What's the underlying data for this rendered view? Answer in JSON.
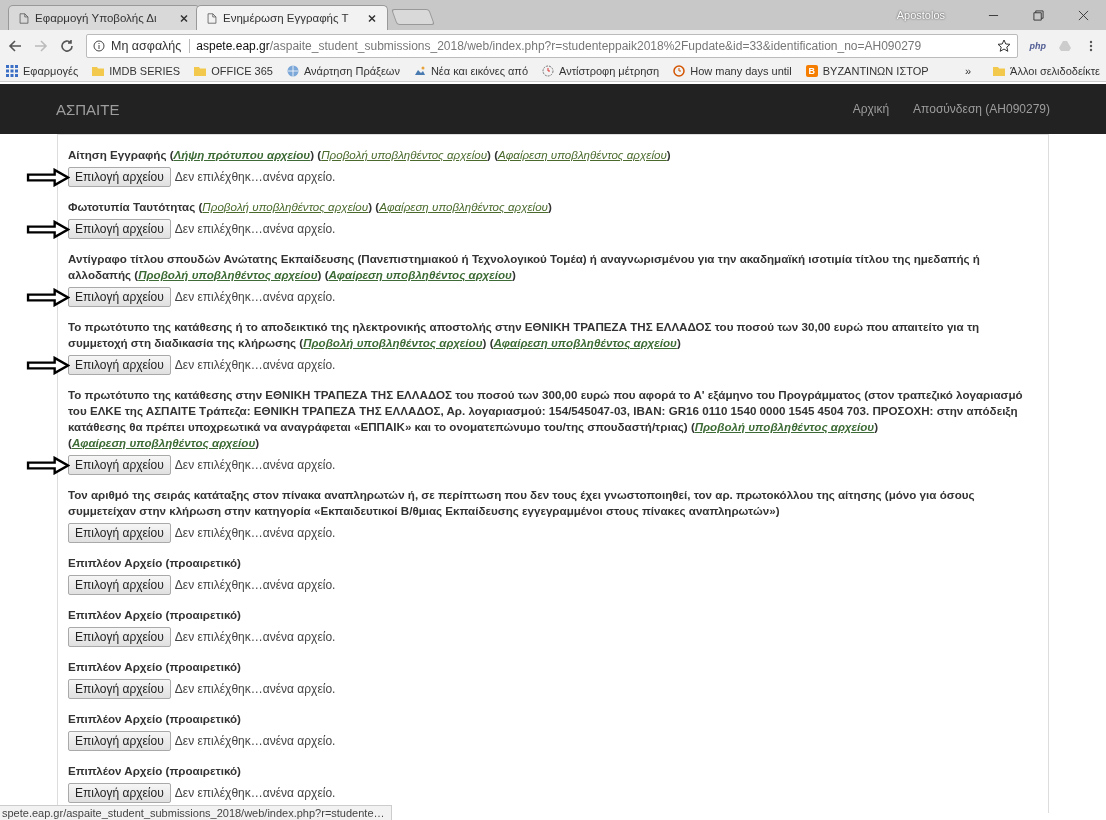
{
  "browser": {
    "tabs": [
      {
        "title": "Εφαρμογή Υποβολής Δι",
        "selected": false
      },
      {
        "title": "Ενημέρωση Εγγραφής Τ",
        "selected": true
      }
    ],
    "profile": "Apostolos",
    "address": {
      "security": "Μη ασφαλής",
      "host": "aspete.eap.gr",
      "path": "/aspaite_student_submissions_2018/web/index.php?r=studenteppaik2018%2Fupdate&id=33&identification_no=AH090279"
    },
    "extension_label": "php",
    "bookmarks": [
      {
        "kind": "apps",
        "label": "Εφαρμογές"
      },
      {
        "kind": "folder",
        "label": "IMDB SERIES"
      },
      {
        "kind": "folder",
        "label": "OFFICE 365"
      },
      {
        "kind": "globe",
        "label": "Ανάρτηση Πράξεων"
      },
      {
        "kind": "picture",
        "label": "Νέα και εικόνες από"
      },
      {
        "kind": "timer",
        "label": "Αντίστροφη μέτρηση"
      },
      {
        "kind": "clock",
        "label": "How many days until"
      },
      {
        "kind": "letter",
        "badge": "B",
        "label": "ΒΥΖΑΝΤΙΝΩΝ ΙΣΤΟΡ"
      }
    ],
    "more_bookmarks": "»",
    "other_bookmarks": "Άλλοι σελιδοδείκτε",
    "status_url": "spete.eap.gr/aspaite_student_submissions_2018/web/index.php?r=studente…"
  },
  "navbar": {
    "brand": "ΑΣΠΑΙΤΕ",
    "links": [
      "Αρχική",
      "Αποσύνδεση (ΑΗ090279)"
    ]
  },
  "sections": [
    {
      "arrow": true,
      "label": [
        {
          "kind": "text",
          "text": "Αίτηση Εγγραφής ("
        },
        {
          "kind": "link",
          "bold": true,
          "text": "Λήψη πρότυπου αρχείου"
        },
        {
          "kind": "text",
          "text": ") ("
        },
        {
          "kind": "link",
          "bold": false,
          "text": "Προβολή υποβληθέντος αρχείου"
        },
        {
          "kind": "text",
          "text": ") ("
        },
        {
          "kind": "link",
          "bold": false,
          "text": "Αφαίρεση υποβληθέντος αρχείου"
        },
        {
          "kind": "text",
          "text": ")"
        }
      ],
      "button": "Επιλογή αρχείου",
      "file_status": "Δεν επιλέχθηκ…ανένα αρχείο."
    },
    {
      "arrow": true,
      "label": [
        {
          "kind": "text",
          "text": "Φωτοτυπία Ταυτότητας ("
        },
        {
          "kind": "link",
          "bold": false,
          "text": "Προβολή υποβληθέντος αρχείου"
        },
        {
          "kind": "text",
          "text": ") ("
        },
        {
          "kind": "link",
          "bold": false,
          "text": "Αφαίρεση υποβληθέντος αρχείου"
        },
        {
          "kind": "text",
          "text": ")"
        }
      ],
      "button": "Επιλογή αρχείου",
      "file_status": "Δεν επιλέχθηκ…ανένα αρχείο."
    },
    {
      "arrow": true,
      "label": [
        {
          "kind": "text",
          "text": "Αντίγραφο τίτλου σπουδών Ανώτατης Εκπαίδευσης (Πανεπιστημιακού ή Τεχνολογικού Τομέα) ή αναγνωρισμένου για την ακαδημαϊκή ισοτιμία τίτλου της ημεδαπής ή αλλοδαπής ("
        },
        {
          "kind": "link",
          "bold": true,
          "text": "Προβολή υποβληθέντος αρχείου"
        },
        {
          "kind": "text",
          "text": ") ("
        },
        {
          "kind": "link",
          "bold": true,
          "text": "Αφαίρεση υποβληθέντος αρχείου"
        },
        {
          "kind": "text",
          "text": ")"
        }
      ],
      "button": "Επιλογή αρχείου",
      "file_status": "Δεν επιλέχθηκ…ανένα αρχείο."
    },
    {
      "arrow": true,
      "label": [
        {
          "kind": "text",
          "text": "Το πρωτότυπο της κατάθεσης ή το αποδεικτικό της ηλεκτρονικής αποστολής στην ΕΘΝΙΚΗ ΤΡΑΠΕΖΑ ΤΗΣ ΕΛΛΑΔΟΣ του ποσού των 30,00 ευρώ που απαιτείτο για τη συμμετοχή στη διαδικασία της κλήρωσης ("
        },
        {
          "kind": "link",
          "bold": true,
          "text": "Προβολή υποβληθέντος αρχείου"
        },
        {
          "kind": "text",
          "text": ") ("
        },
        {
          "kind": "link",
          "bold": true,
          "text": "Αφαίρεση υποβληθέντος αρχείου"
        },
        {
          "kind": "text",
          "text": ")"
        }
      ],
      "button": "Επιλογή αρχείου",
      "file_status": "Δεν επιλέχθηκ…ανένα αρχείο."
    },
    {
      "arrow": true,
      "label": [
        {
          "kind": "text",
          "text": "Το πρωτότυπο της κατάθεσης στην ΕΘΝΙΚΗ ΤΡΑΠΕΖΑ ΤΗΣ ΕΛΛΑΔΟΣ του ποσού των 300,00 ευρώ που αφορά το Α' εξάμηνο του Προγράμματος (στον τραπεζικό λογαριασμό του ΕΛΚΕ της ΑΣΠΑΙΤΕ Τράπεζα: ΕΘΝΙΚΗ ΤΡΑΠΕΖΑ ΤΗΣ ΕΛΛΑΔΟΣ, Αρ. λογαριασμού: 154/545047-03, IBAN: GR16 0110 1540 0000 1545 4504 703. ΠΡΟΣΟΧΗ: στην απόδειξη κατάθεσης θα πρέπει υποχρεωτικά να αναγράφεται «ΕΠΠΑΙΚ» και το ονοματεπώνυμο του/της σπουδαστή/τριας) ("
        },
        {
          "kind": "link",
          "bold": true,
          "text": "Προβολή υποβληθέντος αρχείου"
        },
        {
          "kind": "text",
          "text": ") ("
        },
        {
          "kind": "link",
          "bold": true,
          "text": "Αφαίρεση υποβληθέντος αρχείου"
        },
        {
          "kind": "text",
          "text": ")"
        }
      ],
      "button": "Επιλογή αρχείου",
      "file_status": "Δεν επιλέχθηκ…ανένα αρχείο."
    },
    {
      "arrow": false,
      "label": [
        {
          "kind": "text",
          "text": "Τον αριθμό της σειράς κατάταξης στον πίνακα αναπληρωτών ή, σε περίπτωση που δεν τους έχει γνωστοποιηθεί, τον αρ. πρωτοκόλλου της αίτησης (μόνο για όσους συμμετείχαν στην κλήρωση στην κατηγορία «Εκπαιδευτικοί Β/θμιας Εκπαίδευσης εγγεγραμμένοι στους πίνακες αναπληρωτών»)"
        }
      ],
      "button": "Επιλογή αρχείου",
      "file_status": "Δεν επιλέχθηκ…ανένα αρχείο."
    },
    {
      "arrow": false,
      "label": [
        {
          "kind": "text",
          "text": "Επιπλέον Αρχείο (προαιρετικό)"
        }
      ],
      "button": "Επιλογή αρχείου",
      "file_status": "Δεν επιλέχθηκ…ανένα αρχείο."
    },
    {
      "arrow": false,
      "label": [
        {
          "kind": "text",
          "text": "Επιπλέον Αρχείο (προαιρετικό)"
        }
      ],
      "button": "Επιλογή αρχείου",
      "file_status": "Δεν επιλέχθηκ…ανένα αρχείο."
    },
    {
      "arrow": false,
      "label": [
        {
          "kind": "text",
          "text": "Επιπλέον Αρχείο (προαιρετικό)"
        }
      ],
      "button": "Επιλογή αρχείου",
      "file_status": "Δεν επιλέχθηκ…ανένα αρχείο."
    },
    {
      "arrow": false,
      "label": [
        {
          "kind": "text",
          "text": "Επιπλέον Αρχείο (προαιρετικό)"
        }
      ],
      "button": "Επιλογή αρχείου",
      "file_status": "Δεν επιλέχθηκ…ανένα αρχείο."
    },
    {
      "arrow": false,
      "label": [
        {
          "kind": "text",
          "text": "Επιπλέον Αρχείο (προαιρετικό)"
        }
      ],
      "button": "Επιλογή αρχείου",
      "file_status": "Δεν επιλέχθηκ…ανένα αρχείο."
    }
  ]
}
